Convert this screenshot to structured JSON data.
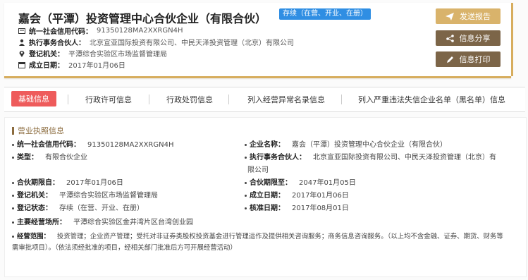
{
  "company": {
    "title": "嘉会（平潭）投资管理中心合伙企业（有限合伙）",
    "status": "存续（在营、开业、在册）",
    "rows": [
      {
        "label": "统一社会信用代码：",
        "value": "91350128MA2XXRGN4H"
      },
      {
        "label": "执行事务合伙人：",
        "value": "北京宣亚国际投资有限公司、中民天泽投资管理（北京）有限公司"
      },
      {
        "label": "登记机关：",
        "value": "平潭综合实验区市场监督管理局"
      },
      {
        "label": "成立日期：",
        "value": "2017年01月06日"
      }
    ]
  },
  "actions": {
    "report": "发送报告",
    "share": "信息分享",
    "print": "信息打印"
  },
  "tabs": [
    "基础信息",
    "行政许可信息",
    "行政处罚信息",
    "列入经营异常名录信息",
    "列入严重违法失信企业名单（黑名单）信息"
  ],
  "section": {
    "title": "营业执照信息"
  },
  "fields": {
    "credit_code": {
      "k": "统一社会信用代码：",
      "v": "91350128MA2XXRGN4H"
    },
    "name": {
      "k": "企业名称：",
      "v": "嘉会（平潭）投资管理中心合伙企业（有限合伙）"
    },
    "type": {
      "k": "类型：",
      "v": "有限合伙企业"
    },
    "partner": {
      "k": "执行事务合伙人：",
      "v1": "北京宣亚国际投资有限公司、中民天泽投资管理（北京）有",
      "v2": "限公司"
    },
    "term_from": {
      "k": "合伙期限自：",
      "v": "2017年01月06日"
    },
    "term_to": {
      "k": "合伙期限至：",
      "v": "2047年01月05日"
    },
    "authority": {
      "k": "登记机关：",
      "v": "平潭综合实验区市场监督管理局"
    },
    "est_date": {
      "k": "成立日期：",
      "v": "2017年01月06日"
    },
    "reg_status": {
      "k": "登记状态：",
      "v": "存续（在营、开业、在册）"
    },
    "approve_date": {
      "k": "核准日期：",
      "v": "2017年08月01日"
    },
    "address": {
      "k": "主要经营场所：",
      "v": "平潭综合实验区金井湾片区台湾创业园"
    },
    "scope": {
      "k": "经营范围：",
      "v1": "投资管理；企业资产管理；受托对非证券类股权投资基金进行管理运作及提供相关咨询服务；商务信息咨询服务。（以上均不含金融、证券、期货、财务等",
      "v2": "需审批项目）。（依法须经批准的项目，经相关部门批准后方可开展经营活动）"
    }
  }
}
